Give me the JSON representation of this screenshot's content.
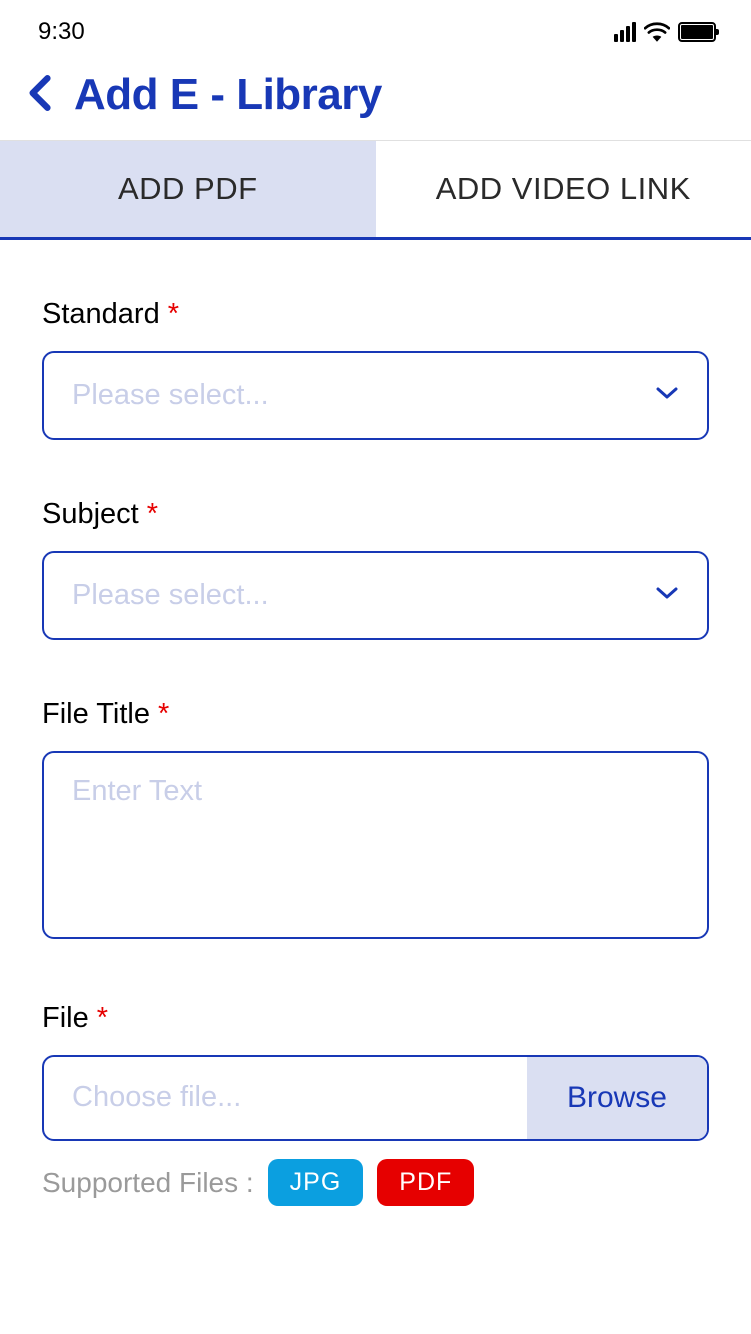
{
  "status_bar": {
    "time": "9:30"
  },
  "header": {
    "title": "Add E - Library"
  },
  "tabs": {
    "items": [
      {
        "label": "ADD PDF",
        "active": true
      },
      {
        "label": "ADD VIDEO LINK",
        "active": false
      }
    ]
  },
  "form": {
    "standard": {
      "label": "Standard",
      "placeholder": "Please select..."
    },
    "subject": {
      "label": "Subject",
      "placeholder": "Please select..."
    },
    "file_title": {
      "label": "File Title",
      "placeholder": "Enter Text"
    },
    "file": {
      "label": "File",
      "placeholder": "Choose file...",
      "browse_label": "Browse"
    },
    "supported": {
      "label": "Supported Files :",
      "badges": [
        "JPG",
        "PDF"
      ]
    },
    "required_mark": "*"
  }
}
